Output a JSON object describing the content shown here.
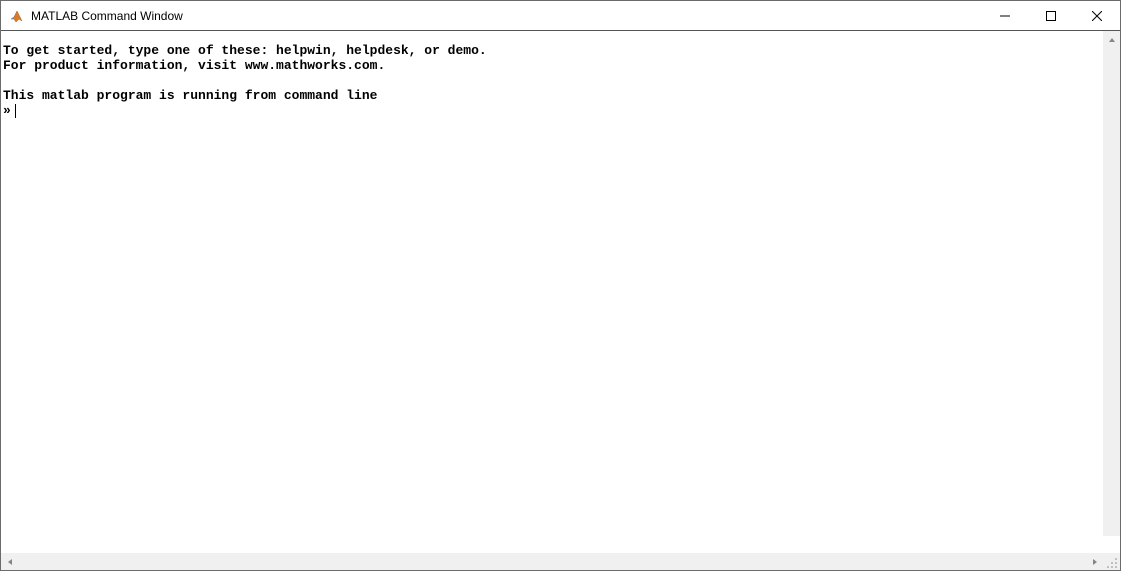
{
  "window": {
    "title": "MATLAB Command Window"
  },
  "console": {
    "line1": "To get started, type one of these: helpwin, helpdesk, or demo.",
    "line2": "For product information, visit www.mathworks.com.",
    "line3": "",
    "line4": "This matlab program is running from command line",
    "prompt": "»"
  }
}
